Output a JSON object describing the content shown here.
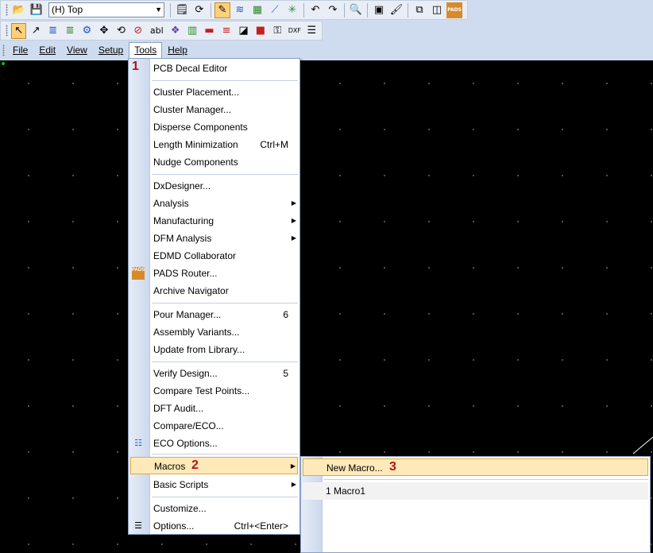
{
  "toolbar1": {
    "layer_value": "(H) Top",
    "icons": [
      "open-icon",
      "save-icon",
      "properties-icon",
      "refresh-icon",
      "redraw-icon",
      "pour-icon",
      "plane-icon",
      "route-icon",
      "flood-icon",
      "undo-icon",
      "redo-icon",
      "zoom-icon",
      "view-icon",
      "brush-icon",
      "window-icon",
      "panel-icon",
      "pads-icon"
    ]
  },
  "toolbar2": {
    "icons": [
      "select-icon",
      "pick-icon",
      "layer-icon",
      "layer-icon-2",
      "part-icon",
      "move-icon",
      "rotate-icon",
      "nodrc-icon",
      "text-icon",
      "attr-icon",
      "book-icon",
      "cut-icon",
      "board-icon",
      "drill-icon",
      "color-icon",
      "component-icon",
      "dxf-icon",
      "list-icon"
    ],
    "text_label": "abl",
    "dxf_label": "DXF"
  },
  "menubar": {
    "items": [
      "File",
      "Edit",
      "View",
      "Setup",
      "Tools",
      "Help"
    ]
  },
  "tools_menu": {
    "items": [
      {
        "label": "PCB Decal Editor"
      },
      {
        "label": "Cluster Placement..."
      },
      {
        "label": "Cluster Manager..."
      },
      {
        "label": "Disperse Components"
      },
      {
        "label": "Length Minimization",
        "shortcut": "Ctrl+M"
      },
      {
        "label": "Nudge Components"
      },
      {
        "label": "DxDesigner..."
      },
      {
        "label": "Analysis"
      },
      {
        "label": "Manufacturing"
      },
      {
        "label": "DFM Analysis"
      },
      {
        "label": "EDMD Collaborator"
      },
      {
        "label": "PADS Router..."
      },
      {
        "label": "Archive Navigator"
      },
      {
        "label": "Pour Manager...",
        "shortcut": "6"
      },
      {
        "label": "Assembly Variants..."
      },
      {
        "label": "Update from Library..."
      },
      {
        "label": "Verify Design...",
        "shortcut": "5"
      },
      {
        "label": "Compare Test Points..."
      },
      {
        "label": "DFT Audit..."
      },
      {
        "label": "Compare/ECO..."
      },
      {
        "label": "ECO Options..."
      },
      {
        "label": "Macros"
      },
      {
        "label": "Basic Scripts"
      },
      {
        "label": "Customize..."
      },
      {
        "label": "Options...",
        "shortcut": "Ctrl+<Enter>"
      }
    ],
    "pads_icon_text": "PADS"
  },
  "macros_submenu": {
    "items": [
      {
        "label": "New Macro..."
      },
      {
        "label": "1 Macro1"
      }
    ]
  },
  "annotations": [
    "1",
    "2",
    "3"
  ],
  "colors": {
    "canvas": "#000000",
    "chrome": "#cfdcef",
    "highlight": "#ffe9b8",
    "annotation": "#b3111b"
  }
}
